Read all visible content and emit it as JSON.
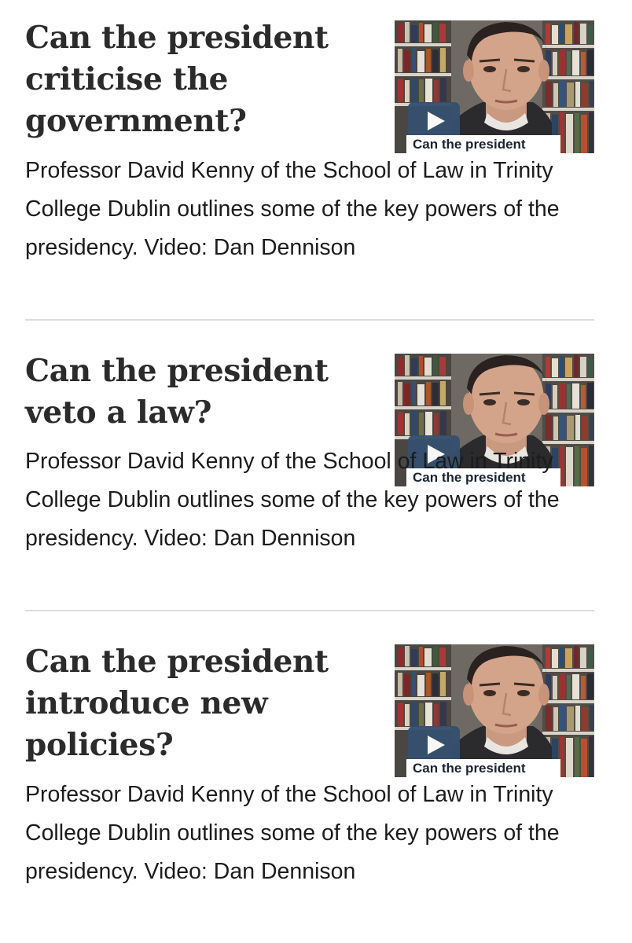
{
  "articles": [
    {
      "title": "Can the president criticise the government?",
      "description": "Professor David Kenny of the School of Law in Trinity College Dublin outlines some of the key powers of the presidency. Video: Dan Dennison",
      "video_caption": "Can the president",
      "play_icon": "play-icon"
    },
    {
      "title": "Can the president veto a law?",
      "description": "Professor David Kenny of the School of Law in Trinity College Dublin outlines some of the key powers of the presidency. Video: Dan Dennison",
      "video_caption": "Can the president",
      "play_icon": "play-icon"
    },
    {
      "title": "Can the president introduce new policies?",
      "description": "Professor David Kenny of the School of Law in Trinity College Dublin outlines some of the key powers of the presidency. Video: Dan Dennison",
      "video_caption": "Can the president",
      "play_icon": "play-icon"
    }
  ],
  "colors": {
    "play_button": "#35506e",
    "divider": "#dcdcdc",
    "title_text": "#2b2b2b"
  }
}
